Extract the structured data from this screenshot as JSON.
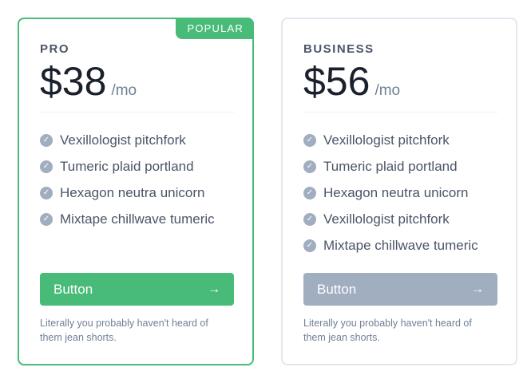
{
  "plans": [
    {
      "name": "PRO",
      "badge": "POPULAR",
      "price": "$38",
      "period": "/mo",
      "features": [
        "Vexillologist pitchfork",
        "Tumeric plaid portland",
        "Hexagon neutra unicorn",
        "Mixtape chillwave tumeric"
      ],
      "button_label": "Button",
      "button_icon": "arrow-right-icon",
      "note": "Literally you probably haven't heard of them jean shorts.",
      "accent_color": "#48bb78"
    },
    {
      "name": "BUSINESS",
      "price": "$56",
      "period": "/mo",
      "features": [
        "Vexillologist pitchfork",
        "Tumeric plaid portland",
        "Hexagon neutra unicorn",
        "Vexillologist pitchfork",
        "Mixtape chillwave tumeric"
      ],
      "button_label": "Button",
      "button_icon": "arrow-right-icon",
      "note": "Literally you probably haven't heard of them jean shorts.",
      "accent_color": "#a0aec0"
    }
  ],
  "icons": {
    "check": "check-circle-icon",
    "arrow": "arrow-right-icon"
  }
}
